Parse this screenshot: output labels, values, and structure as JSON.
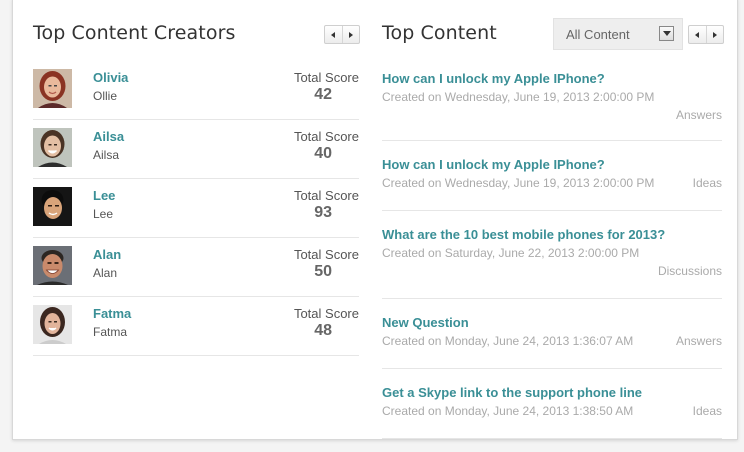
{
  "creators": {
    "title": "Top Content Creators",
    "score_label": "Total Score",
    "items": [
      {
        "name": "Olivia",
        "username": "Ollie",
        "score": "42"
      },
      {
        "name": "Ailsa",
        "username": "Ailsa",
        "score": "40"
      },
      {
        "name": "Lee",
        "username": "Lee",
        "score": "93"
      },
      {
        "name": "Alan",
        "username": "Alan",
        "score": "50"
      },
      {
        "name": "Fatma",
        "username": "Fatma",
        "score": "48"
      }
    ]
  },
  "content": {
    "title": "Top Content",
    "filter": {
      "selected": "All Content"
    },
    "items": [
      {
        "title": "How can I unlock my Apple IPhone?",
        "created": "Created on Wednesday, June 19, 2013 2:00:00 PM",
        "type": "Answers"
      },
      {
        "title": "How can I unlock my Apple IPhone?",
        "created": "Created on Wednesday, June 19, 2013 2:00:00 PM",
        "type": "Ideas"
      },
      {
        "title": "What are the 10 best mobile phones for 2013?",
        "created": "Created on Saturday, June 22, 2013 2:00:00 PM",
        "type": "Discussions"
      },
      {
        "title": "New Question",
        "created": "Created on Monday, June 24, 2013 1:36:07 AM",
        "type": "Answers"
      },
      {
        "title": "Get a Skype link to the support phone line",
        "created": "Created on Monday, June 24, 2013 1:38:50 AM",
        "type": "Ideas"
      }
    ]
  },
  "colors": {
    "link": "#3a8f96",
    "heading": "#333333",
    "muted": "#aaaaaa",
    "divider": "#e6e6e6"
  }
}
